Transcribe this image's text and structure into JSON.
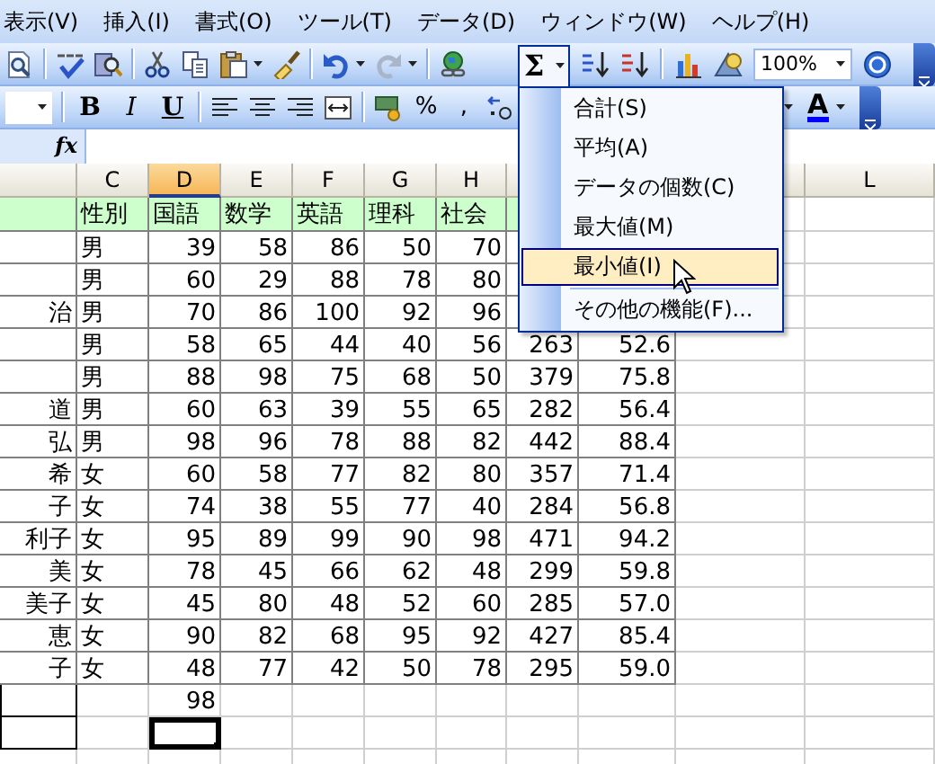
{
  "menu_bar": [
    {
      "label": "表示(V)"
    },
    {
      "label": "挿入(I)"
    },
    {
      "label": "書式(O)"
    },
    {
      "label": "ツール(T)"
    },
    {
      "label": "データ(D)"
    },
    {
      "label": "ウィンドウ(W)"
    },
    {
      "label": "ヘルプ(H)"
    }
  ],
  "standard_toolbar": {
    "autosum": {
      "label": "Σ",
      "expanded": true
    },
    "zoom_field": {
      "value": "100%"
    }
  },
  "formatting_toolbar": {
    "style_buttons": [
      {
        "label": "B",
        "kind": "bold"
      },
      {
        "label": "I",
        "kind": "italic"
      },
      {
        "label": "U",
        "kind": "underline"
      }
    ],
    "percent": "%",
    "comma": ",",
    "font_color": {
      "label": "A"
    }
  },
  "formula_bar": {
    "label": "fx"
  },
  "sheet": {
    "column_headers": [
      {
        "selected": false
      },
      {
        "label": "C",
        "selected": false
      },
      {
        "label": "D",
        "selected": true
      },
      {
        "label": "E",
        "selected": false
      },
      {
        "label": "F",
        "selected": false
      },
      {
        "label": "G",
        "selected": false
      },
      {
        "label": "H",
        "selected": false
      },
      {
        "selected": false
      },
      {
        "selected": false
      },
      {
        "label": "L",
        "selected": false
      }
    ],
    "header_row": [
      "性別",
      "国語",
      "数学",
      "英語",
      "理科",
      "社会"
    ],
    "rows": [
      {
        "gender": "男",
        "scores": [
          "39",
          "58",
          "86",
          "50",
          "70"
        ]
      },
      {
        "gender": "男",
        "scores": [
          "60",
          "29",
          "88",
          "78",
          "80"
        ]
      },
      {
        "name": "治",
        "gender": "男",
        "scores": [
          "70",
          "86",
          "100",
          "92",
          "96"
        ]
      },
      {
        "gender": "男",
        "scores": [
          "58",
          "65",
          "44",
          "40",
          "56"
        ],
        "total": "263",
        "average": "52.6"
      },
      {
        "gender": "男",
        "scores": [
          "88",
          "98",
          "75",
          "68",
          "50"
        ],
        "total": "379",
        "average": "75.8"
      },
      {
        "name": "道",
        "gender": "男",
        "scores": [
          "60",
          "63",
          "39",
          "55",
          "65"
        ],
        "total": "282",
        "average": "56.4"
      },
      {
        "name": "弘",
        "gender": "男",
        "scores": [
          "98",
          "96",
          "78",
          "88",
          "82"
        ],
        "total": "442",
        "average": "88.4"
      },
      {
        "name": "希",
        "gender": "女",
        "scores": [
          "60",
          "58",
          "77",
          "82",
          "80"
        ],
        "total": "357",
        "average": "71.4"
      },
      {
        "name": "子",
        "gender": "女",
        "scores": [
          "74",
          "38",
          "55",
          "77",
          "40"
        ],
        "total": "284",
        "average": "56.8"
      },
      {
        "name": "利子",
        "gender": "女",
        "scores": [
          "95",
          "89",
          "99",
          "90",
          "98"
        ],
        "total": "471",
        "average": "94.2"
      },
      {
        "name": "美",
        "gender": "女",
        "scores": [
          "78",
          "45",
          "66",
          "62",
          "48"
        ],
        "total": "299",
        "average": "59.8"
      },
      {
        "name": "美子",
        "gender": "女",
        "scores": [
          "45",
          "80",
          "48",
          "52",
          "60"
        ],
        "total": "285",
        "average": "57.0"
      },
      {
        "name": "恵",
        "gender": "女",
        "scores": [
          "90",
          "82",
          "68",
          "95",
          "92"
        ],
        "total": "427",
        "average": "85.4"
      },
      {
        "name": "子",
        "gender": "女",
        "scores": [
          "48",
          "77",
          "42",
          "50",
          "78"
        ],
        "total": "295",
        "average": "59.0"
      }
    ],
    "result_cells": [
      {
        "value": "98",
        "selected": false
      },
      {
        "selected": true
      }
    ]
  },
  "autosum_menu": {
    "items": [
      {
        "label": "合計(S)",
        "selected": false
      },
      {
        "label": "平均(A)",
        "selected": false
      },
      {
        "label": "データの個数(C)",
        "selected": false
      },
      {
        "label": "最大値(M)",
        "selected": false
      },
      {
        "label": "最小値(I)",
        "selected": true
      }
    ],
    "more_item": {
      "label": "その他の機能(F)...",
      "selected": false
    }
  }
}
